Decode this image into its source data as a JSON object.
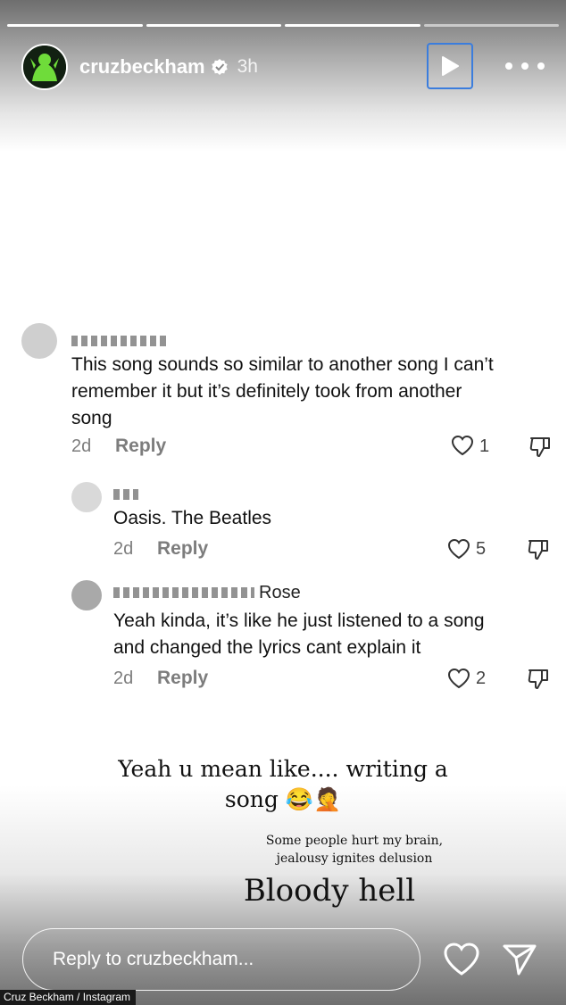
{
  "story": {
    "username": "cruzbeckham",
    "time_ago": "3h",
    "progress_segments": [
      1,
      1,
      1,
      0
    ],
    "reply_placeholder": "Reply to cruzbeckham...",
    "credit": "Cruz Beckham / Instagram"
  },
  "comments": [
    {
      "name_visible": "",
      "text_lines": [
        "This song sounds so similar to another song I can’t",
        "remember it but it’s definitely took from another",
        "song"
      ],
      "age": "2d",
      "reply_label": "Reply",
      "likes": "1"
    },
    {
      "name_visible": "",
      "text_lines": [
        "Oasis. The Beatles"
      ],
      "age": "2d",
      "reply_label": "Reply",
      "likes": "5"
    },
    {
      "name_visible": "Rose",
      "text_lines": [
        "Yeah kinda, it’s like he just listened to a song",
        "and changed the lyrics cant explain it"
      ],
      "age": "2d",
      "reply_label": "Reply",
      "likes": "2"
    }
  ],
  "captions": {
    "main_line1": "Yeah u mean like.... writing a",
    "main_line2": "song 😂🤦",
    "small_line1": "Some people hurt my brain,",
    "small_line2": "jealousy ignites delusion",
    "big": "Bloody hell"
  },
  "colors": {
    "accent": "#3b7ddd",
    "text": "#111111",
    "muted": "#7d7d7d"
  }
}
